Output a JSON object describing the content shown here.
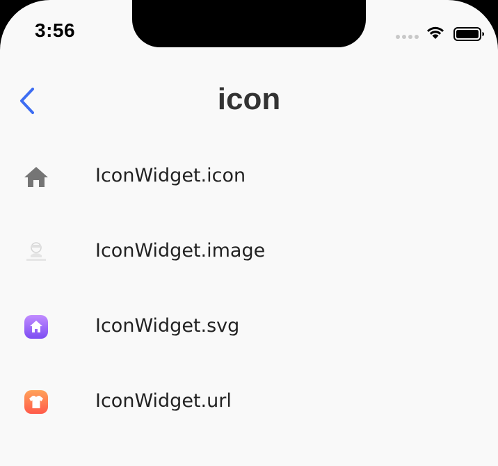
{
  "status_bar": {
    "time": "3:56"
  },
  "nav": {
    "title": "icon",
    "back_icon": "chevron-left-icon",
    "accent_color": "#3d6df2"
  },
  "list": {
    "items": [
      {
        "label": "IconWidget.icon",
        "icon": "home-icon"
      },
      {
        "label": "IconWidget.image",
        "icon": "image-thumbnail-icon"
      },
      {
        "label": "IconWidget.svg",
        "icon": "svg-home-icon"
      },
      {
        "label": "IconWidget.url",
        "icon": "shirt-icon"
      }
    ]
  }
}
